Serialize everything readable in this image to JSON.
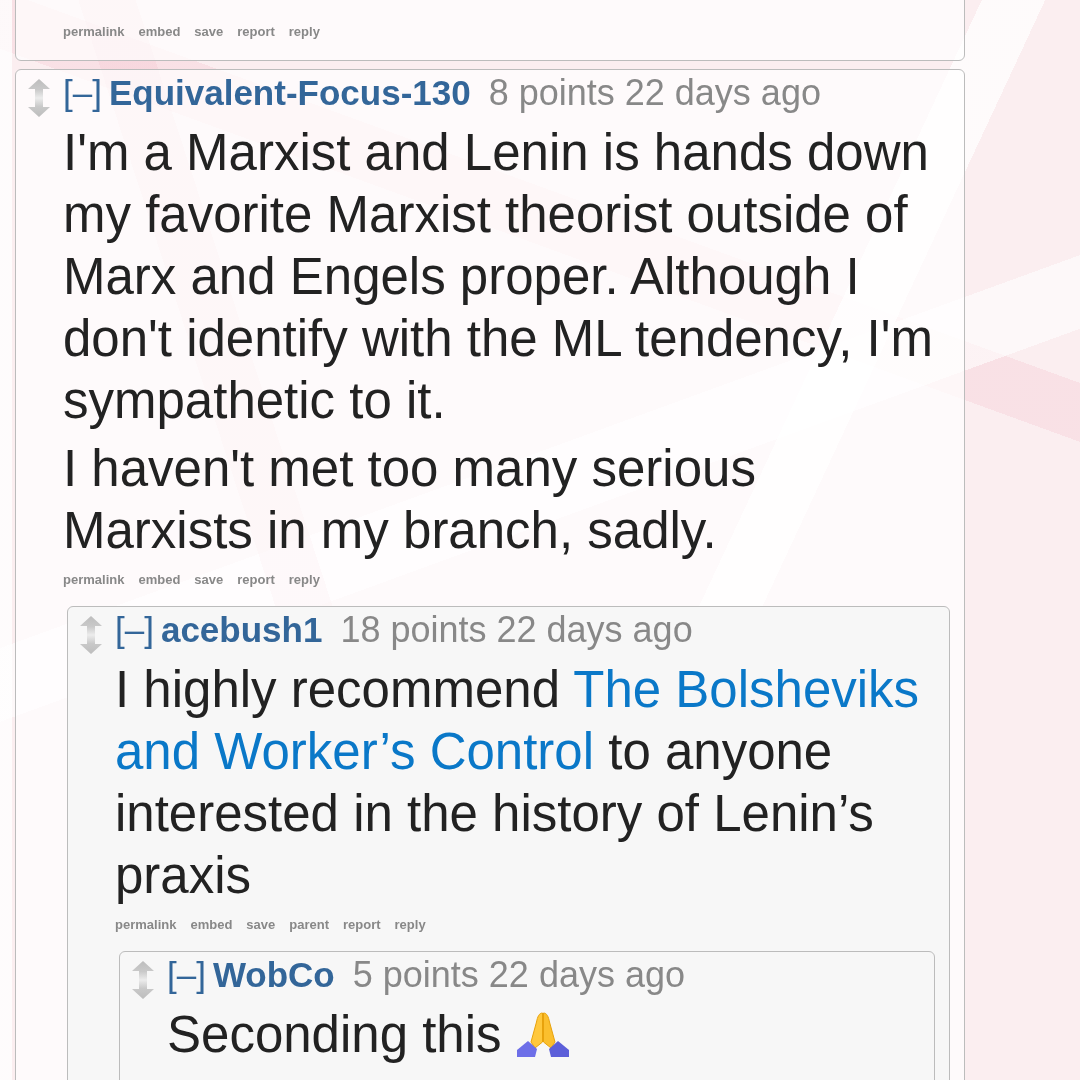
{
  "comments": [
    {
      "actions": [
        "permalink",
        "embed",
        "save",
        "report",
        "reply"
      ]
    },
    {
      "collapse": "[–]",
      "author": "Equivalent-Focus-130",
      "score": "8 points",
      "time": "22 days ago",
      "body": [
        [
          {
            "kind": "text",
            "text": "I'm a Marxist and Lenin is hands down my favorite Marxist theorist outside of Marx and Engels proper. Although I don't identify with the ML tendency, I'm sympathetic to it."
          }
        ],
        [
          {
            "kind": "text",
            "text": "I haven't met too many serious Marxists in my branch, sadly."
          }
        ]
      ],
      "actions": [
        "permalink",
        "embed",
        "save",
        "report",
        "reply"
      ],
      "children": [
        {
          "collapse": "[–]",
          "author": "acebush1",
          "score": "18 points",
          "time": "22 days ago",
          "body": [
            [
              {
                "kind": "text",
                "text": "I highly recommend "
              },
              {
                "kind": "link",
                "text": "The Bolsheviks"
              },
              {
                "kind": "link",
                "text": "and Worker’s Control"
              },
              {
                "kind": "text",
                "text": " to anyone interested in the history of Lenin’s praxis"
              }
            ]
          ],
          "actions": [
            "permalink",
            "embed",
            "save",
            "parent",
            "report",
            "reply"
          ],
          "children": [
            {
              "collapse": "[–]",
              "author": "WobCo",
              "score": "5 points",
              "time": "22 days ago",
              "body": [
                [
                  {
                    "kind": "text",
                    "text": "Seconding this "
                  },
                  {
                    "kind": "emoji"
                  }
                ]
              ]
            }
          ]
        }
      ]
    }
  ]
}
